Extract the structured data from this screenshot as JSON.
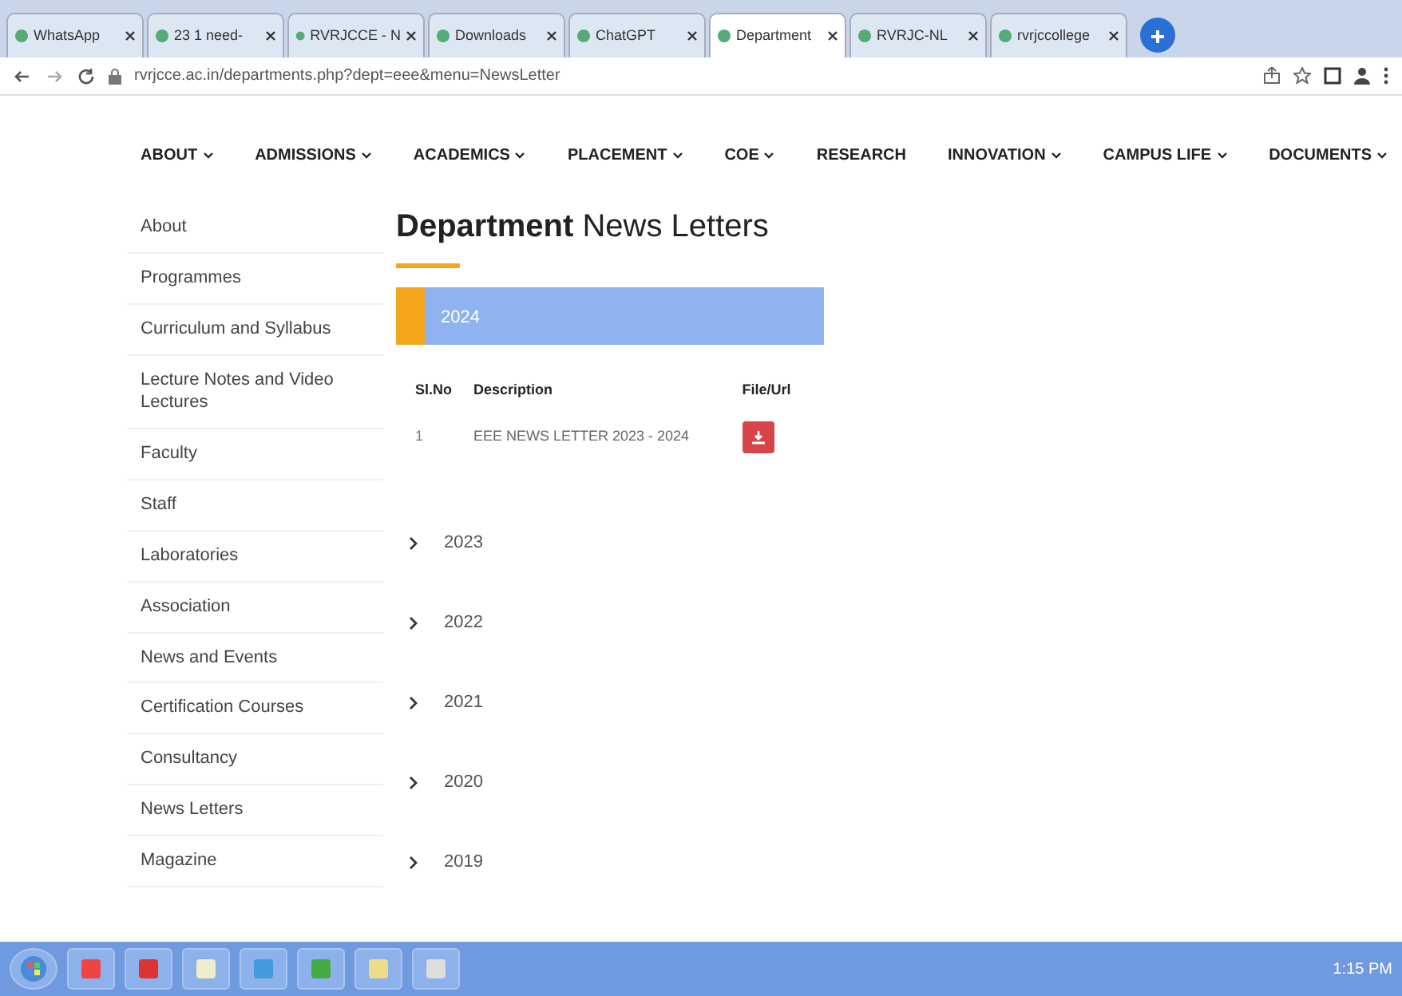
{
  "browser": {
    "tabs": [
      {
        "title": "WhatsApp",
        "selected": false
      },
      {
        "title": "23 1 need-",
        "selected": false
      },
      {
        "title": "RVRJCCE - N",
        "selected": false
      },
      {
        "title": "Downloads",
        "selected": false
      },
      {
        "title": "ChatGPT",
        "selected": false
      },
      {
        "title": "Department",
        "selected": true
      },
      {
        "title": "RVRJC-NL",
        "selected": false
      },
      {
        "title": "rvrjccollege",
        "selected": false
      }
    ],
    "address": "rvrjcce.ac.in/departments.php?dept=eee&menu=NewsLetter"
  },
  "nav": [
    {
      "label": "ABOUT",
      "dropdown": true
    },
    {
      "label": "ADMISSIONS",
      "dropdown": true
    },
    {
      "label": "ACADEMICS",
      "dropdown": true
    },
    {
      "label": "PLACEMENT",
      "dropdown": true
    },
    {
      "label": "COE",
      "dropdown": true
    },
    {
      "label": "RESEARCH",
      "dropdown": false
    },
    {
      "label": "INNOVATION",
      "dropdown": true
    },
    {
      "label": "CAMPUS LIFE",
      "dropdown": true
    },
    {
      "label": "DOCUMENTS",
      "dropdown": true
    }
  ],
  "sidebar": {
    "items": [
      "About",
      "Programmes",
      "Curriculum and Syllabus",
      "Lecture Notes and Video Lectures",
      "Faculty",
      "Staff",
      "Laboratories",
      "Association",
      "News and Events",
      "Certification Courses",
      "Consultancy",
      "News Letters",
      "Magazine"
    ]
  },
  "heading": "**Department** News Letters",
  "years": [
    {
      "year": "2024",
      "expanded": true,
      "table": {
        "columns": [
          "Sl.No",
          "Description",
          "File/Url"
        ],
        "rows": [
          {
            "sl": "1",
            "description": "EEE NEWS LETTER 2023 - 2024"
          }
        ]
      }
    },
    {
      "year": "2023",
      "expanded": false
    },
    {
      "year": "2022",
      "expanded": false
    },
    {
      "year": "2021",
      "expanded": false
    },
    {
      "year": "2020",
      "expanded": false
    },
    {
      "year": "2019",
      "expanded": false
    }
  ],
  "taskbar": {
    "clock": "1:15 PM"
  }
}
